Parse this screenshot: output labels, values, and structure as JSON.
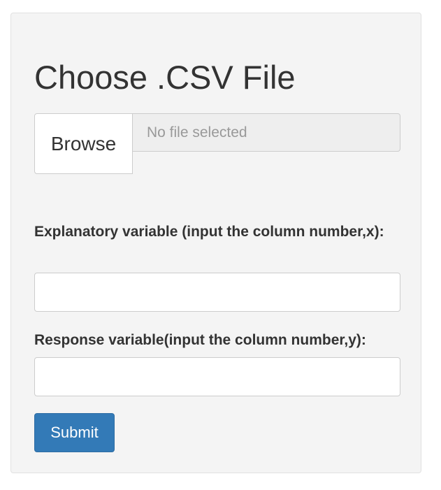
{
  "form": {
    "title": "Choose .CSV File",
    "browse_label": "Browse",
    "file_placeholder": "No file selected",
    "explanatory_label": "Explanatory variable (input the column number,x):",
    "explanatory_value": "",
    "response_label": "Response variable(input the column number,y):",
    "response_value": "",
    "submit_label": "Submit"
  },
  "colors": {
    "panel_background": "#f4f4f4",
    "submit_button": "#337ab7",
    "file_display_background": "#eeeeee",
    "text": "#333333",
    "placeholder_text": "#999999"
  }
}
